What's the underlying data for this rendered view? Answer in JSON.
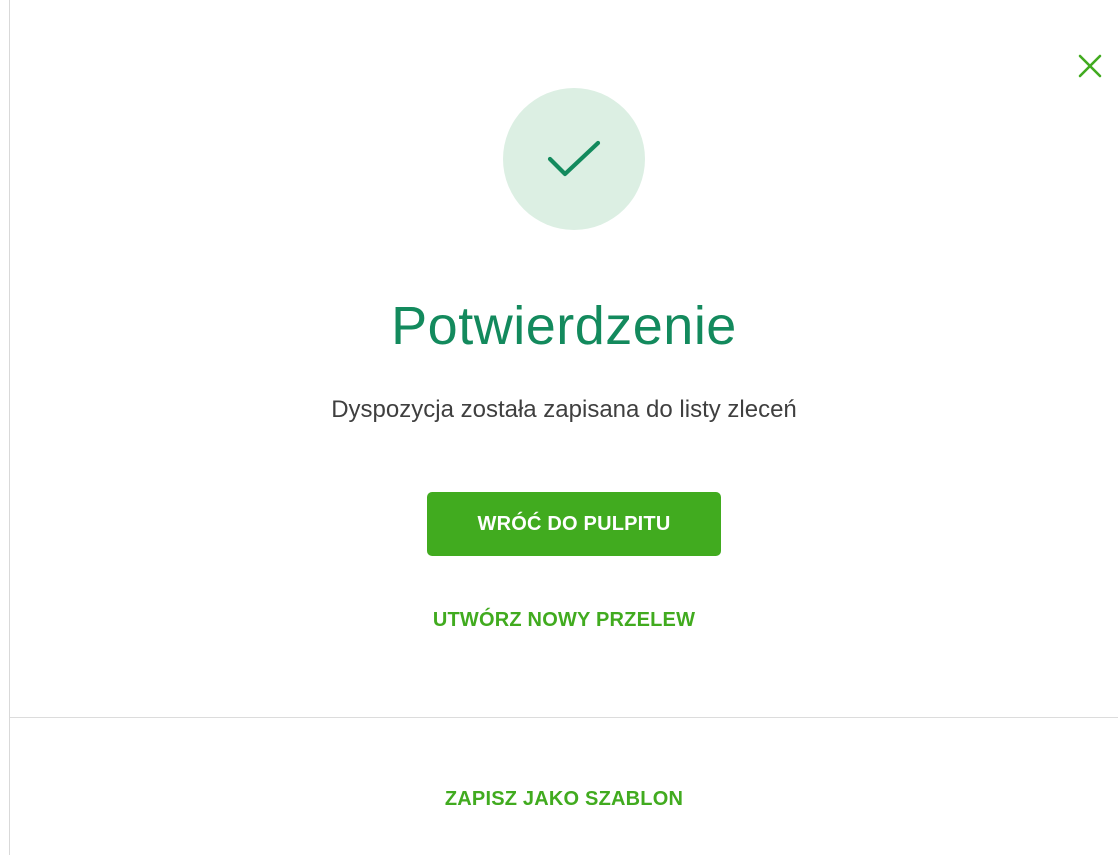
{
  "dialog": {
    "title": "Potwierdzenie",
    "message": "Dyspozycja została zapisana do listy zleceń",
    "close_icon": "close-icon",
    "status_icon": "checkmark-icon"
  },
  "actions": {
    "primary_label": "WRÓĆ DO PULPITU",
    "secondary_label": "UTWÓRZ NOWY PRZELEW",
    "footer_label": "ZAPISZ JAKO SZABLON"
  },
  "colors": {
    "accent_green": "#41ab1f",
    "title_green": "#138a5d",
    "circle_bg": "#dcefe3"
  }
}
